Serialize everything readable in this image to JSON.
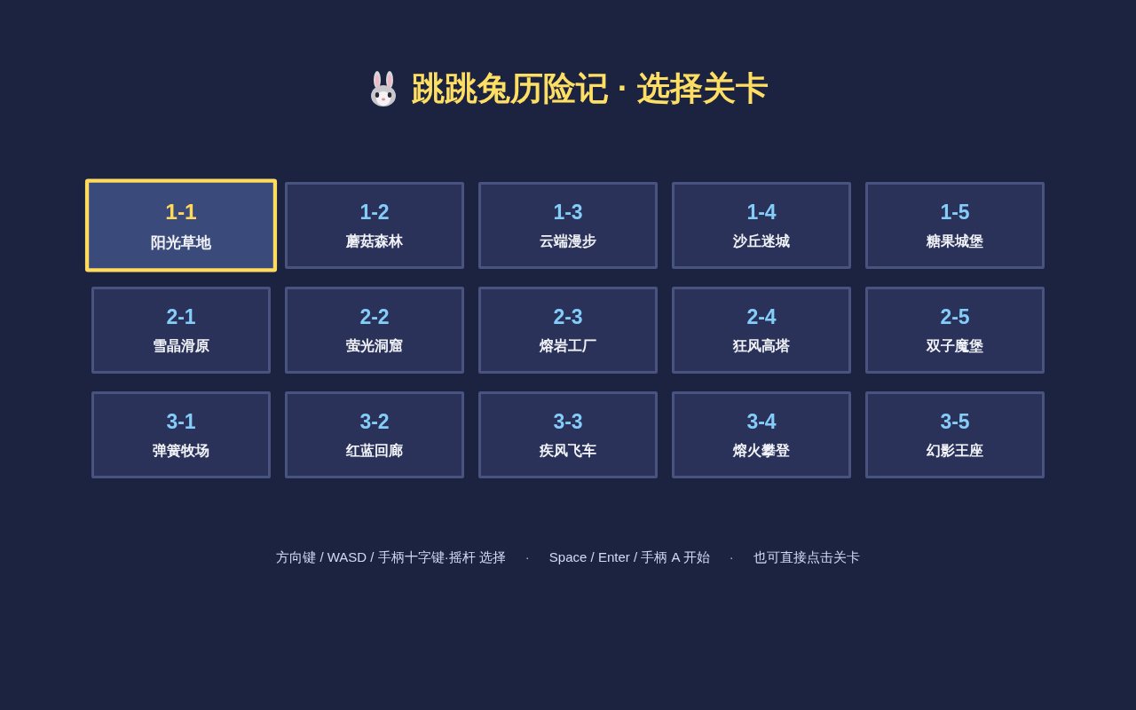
{
  "title": {
    "text": "跳跳兔历险记 · 选择关卡"
  },
  "levels": [
    {
      "number": "1-1",
      "name": "阳光草地",
      "selected": true
    },
    {
      "number": "1-2",
      "name": "蘑菇森林",
      "selected": false
    },
    {
      "number": "1-3",
      "name": "云端漫步",
      "selected": false
    },
    {
      "number": "1-4",
      "name": "沙丘迷城",
      "selected": false
    },
    {
      "number": "1-5",
      "name": "糖果城堡",
      "selected": false
    },
    {
      "number": "2-1",
      "name": "雪晶滑原",
      "selected": false
    },
    {
      "number": "2-2",
      "name": "萤光洞窟",
      "selected": false
    },
    {
      "number": "2-3",
      "name": "熔岩工厂",
      "selected": false
    },
    {
      "number": "2-4",
      "name": "狂风高塔",
      "selected": false
    },
    {
      "number": "2-5",
      "name": "双子魔堡",
      "selected": false
    },
    {
      "number": "3-1",
      "name": "弹簧牧场",
      "selected": false
    },
    {
      "number": "3-2",
      "name": "红蓝回廊",
      "selected": false
    },
    {
      "number": "3-3",
      "name": "疾风飞车",
      "selected": false
    },
    {
      "number": "3-4",
      "name": "熔火攀登",
      "selected": false
    },
    {
      "number": "3-5",
      "name": "幻影王座",
      "selected": false
    }
  ],
  "footer": [
    {
      "kind": "hint",
      "text": "方向键 / WASD / 手柄十字键·摇杆 选择"
    },
    {
      "kind": "separator",
      "text": "·"
    },
    {
      "kind": "hint",
      "text": "Space / Enter / 手柄 A 开始"
    },
    {
      "kind": "separator",
      "text": "·"
    },
    {
      "kind": "hint",
      "text": "也可直接点击关卡"
    }
  ]
}
